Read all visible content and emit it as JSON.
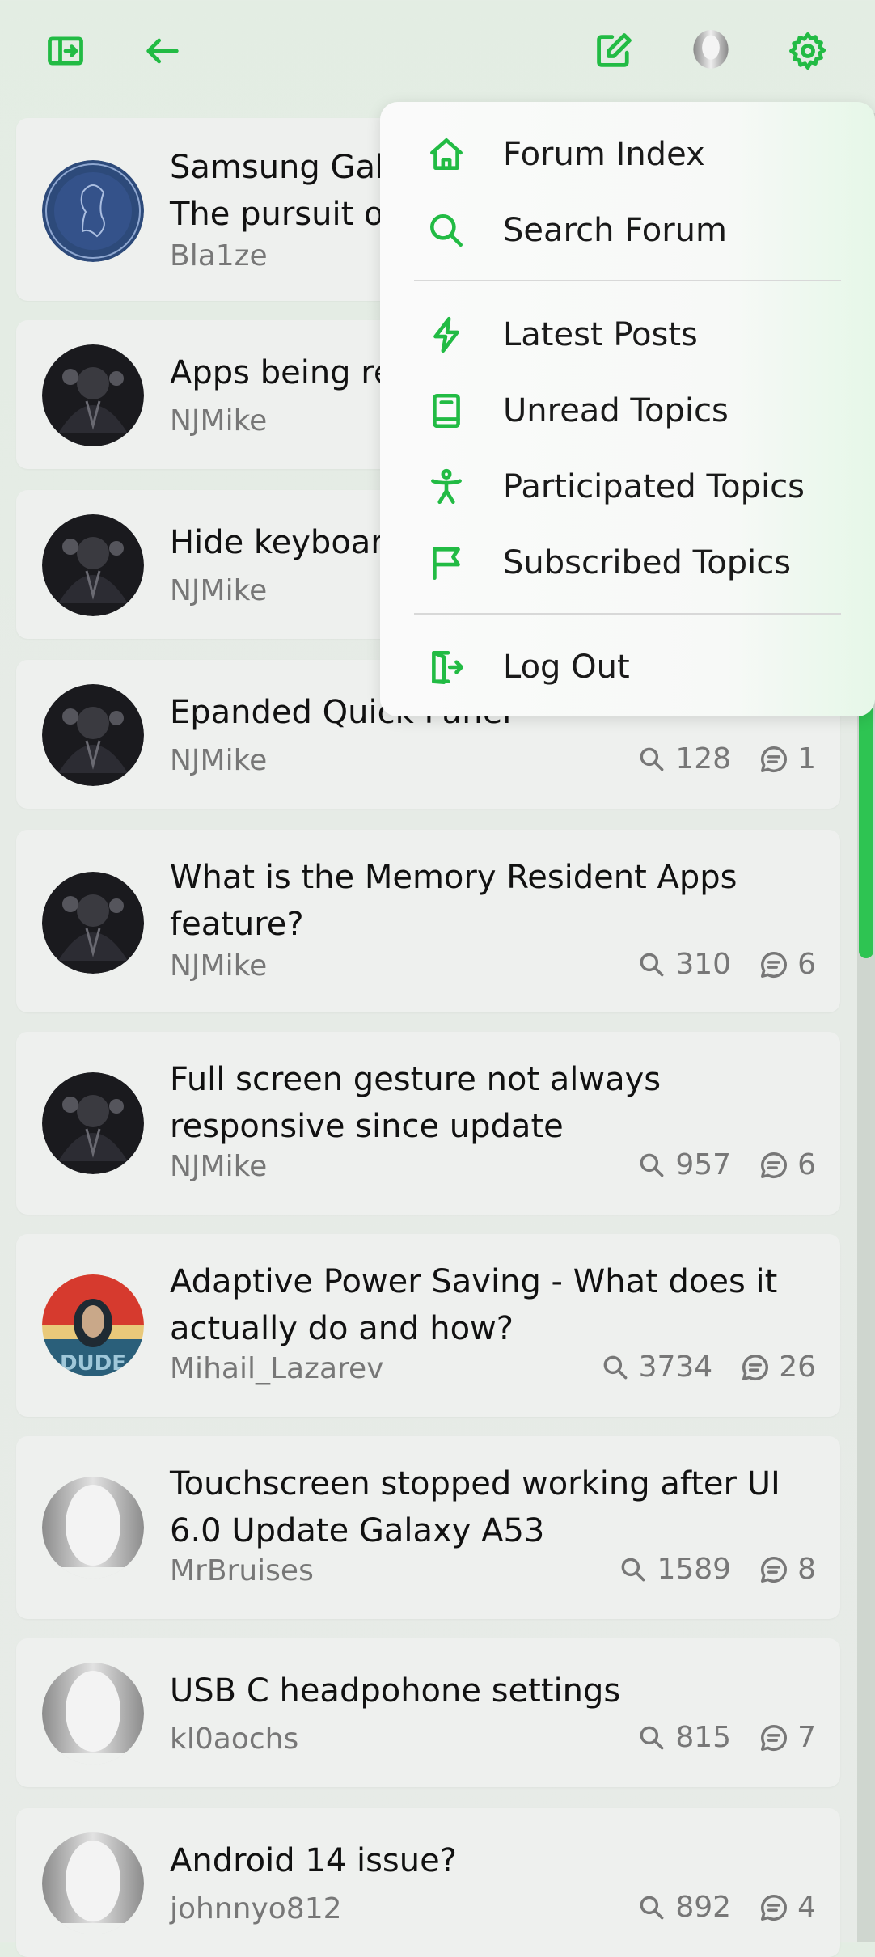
{
  "topbar": {
    "left_icons": [
      "sidebar-toggle-icon",
      "back-arrow-icon"
    ],
    "right_icons": [
      "compose-icon",
      "user-avatar-icon",
      "settings-gear-icon"
    ]
  },
  "colors": {
    "accent": "#22bb44",
    "menu_gradient_end": "#e6f7e8"
  },
  "menu": {
    "group1": [
      {
        "label": "Forum Index",
        "icon": "home-icon"
      },
      {
        "label": "Search Forum",
        "icon": "search-icon"
      }
    ],
    "group2": [
      {
        "label": "Latest Posts",
        "icon": "lightning-icon"
      },
      {
        "label": "Unread Topics",
        "icon": "book-icon"
      },
      {
        "label": "Participated Topics",
        "icon": "person-icon"
      },
      {
        "label": "Subscribed Topics",
        "icon": "flag-icon"
      }
    ],
    "group3": [
      {
        "label": "Log Out",
        "icon": "logout-icon"
      }
    ]
  },
  "topics": [
    {
      "title": "Samsung Gal\nThe pursuit o",
      "author": "Bla1ze",
      "views": "",
      "replies": "",
      "avatar": "emblem"
    },
    {
      "title": "Apps being re",
      "author": "NJMike",
      "views": "",
      "replies": "",
      "avatar": "dark"
    },
    {
      "title": "Hide keyboar",
      "author": "NJMike",
      "views": "",
      "replies": "",
      "avatar": "dark"
    },
    {
      "title": "Epanded Quick Panel",
      "author": "NJMike",
      "views": "128",
      "replies": "1",
      "avatar": "dark"
    },
    {
      "title": "What is the Memory Resident Apps\nfeature?",
      "author": "NJMike",
      "views": "310",
      "replies": "6",
      "avatar": "dark"
    },
    {
      "title": "Full screen gesture not always\nresponsive since update",
      "author": "NJMike",
      "views": "957",
      "replies": "6",
      "avatar": "dark"
    },
    {
      "title": "Adaptive Power Saving - What does it\nactually do and how?",
      "author": "Mihail_Lazarev",
      "views": "3734",
      "replies": "26",
      "avatar": "poster"
    },
    {
      "title": "Touchscreen stopped working after UI\n6.0 Update Galaxy A53",
      "author": "MrBruises",
      "views": "1589",
      "replies": "8",
      "avatar": "default"
    },
    {
      "title": "USB C headpohone settings",
      "author": "kl0aochs",
      "views": "815",
      "replies": "7",
      "avatar": "default"
    },
    {
      "title": "Android 14 issue?",
      "author": "johnnyo812",
      "views": "892",
      "replies": "4",
      "avatar": "default"
    }
  ],
  "avatar_text": {
    "poster": "DUDE"
  }
}
